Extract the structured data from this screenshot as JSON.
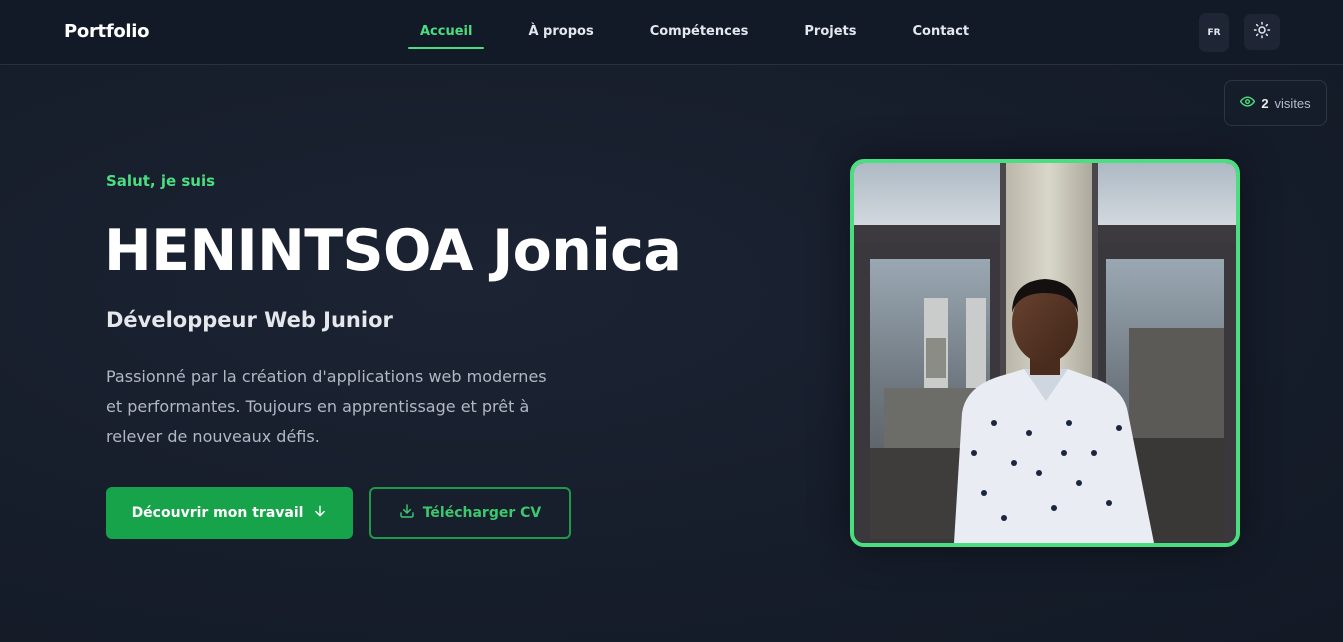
{
  "header": {
    "brand": "Portfolio",
    "nav": [
      {
        "label": "Accueil",
        "active": true
      },
      {
        "label": "À propos",
        "active": false
      },
      {
        "label": "Compétences",
        "active": false
      },
      {
        "label": "Projets",
        "active": false
      },
      {
        "label": "Contact",
        "active": false
      }
    ],
    "lang": "FR",
    "theme_icon": "sun-icon"
  },
  "visits": {
    "icon": "eye-icon",
    "count": "2",
    "label": "visites"
  },
  "hero": {
    "greeting": "Salut, je suis",
    "name": "HENINTSOA Jonica",
    "role": "Développeur Web Junior",
    "description": "Passionné par la création d'applications web modernes et performantes. Toujours en apprentissage et prêt à relever de nouveaux défis.",
    "primary_button": {
      "label": "Découvrir mon travail",
      "icon": "arrow-down-icon"
    },
    "secondary_button": {
      "label": "Télécharger CV",
      "icon": "download-icon"
    }
  },
  "colors": {
    "accent": "#4ade80",
    "button_green": "#16a34a",
    "background": "#151c2a",
    "navbar": "#121927"
  }
}
